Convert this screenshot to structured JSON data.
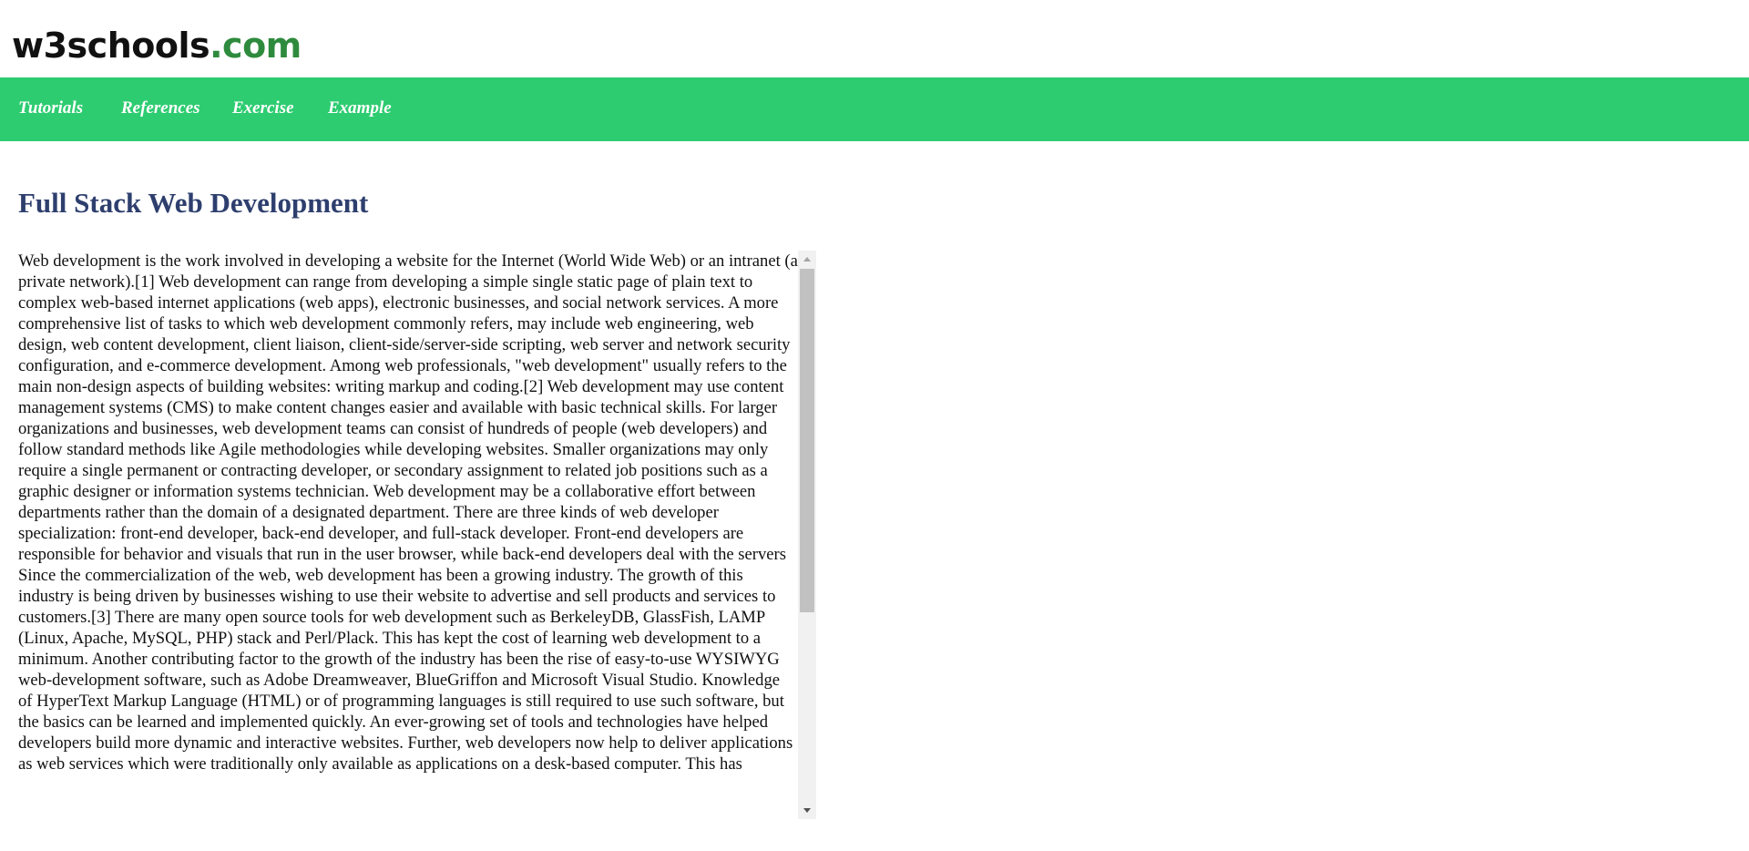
{
  "logo": {
    "main": "w3schools",
    "accent": ".com"
  },
  "nav": {
    "items": [
      {
        "label": "Tutorials"
      },
      {
        "label": "References"
      },
      {
        "label": "Exercise"
      },
      {
        "label": "Example"
      }
    ]
  },
  "main": {
    "title": "Full Stack Web Development",
    "body": "Web development is the work involved in developing a website for the Internet (World Wide Web) or an intranet (a private network).[1] Web development can range from developing a simple single static page of plain text to complex web-based internet applications (web apps), electronic businesses, and social network services. A more comprehensive list of tasks to which web development commonly refers, may include web engineering, web design, web content development, client liaison, client-side/server-side scripting, web server and network security configuration, and e-commerce development. Among web professionals, \"web development\" usually refers to the main non-design aspects of building websites: writing markup and coding.[2] Web development may use content management systems (CMS) to make content changes easier and available with basic technical skills. For larger organizations and businesses, web development teams can consist of hundreds of people (web developers) and follow standard methods like Agile methodologies while developing websites. Smaller organizations may only require a single permanent or contracting developer, or secondary assignment to related job positions such as a graphic designer or information systems technician. Web development may be a collaborative effort between departments rather than the domain of a designated department. There are three kinds of web developer specialization: front-end developer, back-end developer, and full-stack developer. Front-end developers are responsible for behavior and visuals that run in the user browser, while back-end developers deal with the servers Since the commercialization of the web, web development has been a growing industry. The growth of this industry is being driven by businesses wishing to use their website to advertise and sell products and services to customers.[3] There are many open source tools for web development such as BerkeleyDB, GlassFish, LAMP (Linux, Apache, MySQL, PHP) stack and Perl/Plack. This has kept the cost of learning web development to a minimum. Another contributing factor to the growth of the industry has been the rise of easy-to-use WYSIWYG web-development software, such as Adobe Dreamweaver, BlueGriffon and Microsoft Visual Studio. Knowledge of HyperText Markup Language (HTML) or of programming languages is still required to use such software, but the basics can be learned and implemented quickly. An ever-growing set of tools and technologies have helped developers build more dynamic and interactive websites. Further, web developers now help to deliver applications as web services which were traditionally only available as applications on a desk-based computer. This has"
  },
  "colors": {
    "nav_background": "#2ecc71",
    "logo_accent": "#2e8b3e",
    "title": "#2e3f6e",
    "body_text": "#111111"
  }
}
